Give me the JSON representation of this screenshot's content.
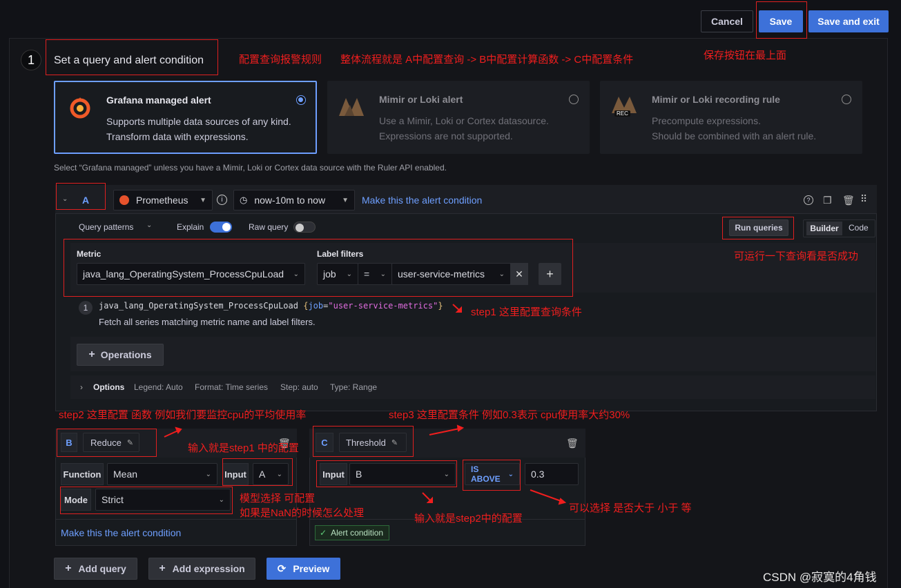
{
  "header": {
    "cancel_label": "Cancel",
    "save_label": "Save",
    "save_exit_label": "Save and exit"
  },
  "section": {
    "step_number": "1",
    "title": "Set a query and alert condition"
  },
  "alert_types": [
    {
      "title": "Grafana managed alert",
      "desc1": "Supports multiple data sources of any kind.",
      "desc2": "Transform data with expressions.",
      "selected": true
    },
    {
      "title": "Mimir or Loki alert",
      "desc1": "Use a Mimir, Loki or Cortex datasource.",
      "desc2": "Expressions are not supported.",
      "selected": false
    },
    {
      "title": "Mimir or Loki recording rule",
      "desc1": "Precompute expressions.",
      "desc2": "Should be combined with an alert rule.",
      "selected": false,
      "badge": "REC"
    }
  ],
  "hint": "Select “Grafana managed” unless you have a Mimir, Loki or Cortex data source with the Ruler API enabled.",
  "query_a": {
    "ref": "A",
    "datasource": "Prometheus",
    "time_range": "now-10m to now",
    "condition_link": "Make this the alert condition",
    "query_patterns": "Query patterns",
    "explain_label": "Explain",
    "raw_query_label": "Raw query",
    "run_queries": "Run queries",
    "builder_label": "Builder",
    "code_label": "Code",
    "metric_label": "Metric",
    "metric_value": "java_lang_OperatingSystem_ProcessCpuLoad",
    "label_filters_label": "Label filters",
    "filter_key": "job",
    "filter_op": "=",
    "filter_value": "user-service-metrics",
    "explain_num": "1",
    "explain_metric": "java_lang_OperatingSystem_ProcessCpuLoad",
    "explain_brace_open": "{",
    "explain_key": "job",
    "explain_eq": "=",
    "explain_val": "\"user-service-metrics\"",
    "explain_brace_close": "}",
    "explain_desc": "Fetch all series matching metric name and label filters.",
    "operations_label": "Operations",
    "options_label": "Options",
    "legend": "Legend: Auto",
    "format": "Format: Time series",
    "step": "Step: auto",
    "type": "Type: Range"
  },
  "expr_b": {
    "ref": "B",
    "name": "Reduce",
    "function_label": "Function",
    "function_value": "Mean",
    "input_label": "Input",
    "input_value": "A",
    "mode_label": "Mode",
    "mode_value": "Strict",
    "condition_link": "Make this the alert condition"
  },
  "expr_c": {
    "ref": "C",
    "name": "Threshold",
    "input_label": "Input",
    "input_value": "B",
    "op_value": "IS ABOVE",
    "threshold_value": "0.3",
    "alert_condition_badge": "Alert condition"
  },
  "footer": {
    "add_query": "Add query",
    "add_expression": "Add expression",
    "preview": "Preview"
  },
  "annotations": {
    "a1": "配置查询报警规则",
    "a2": "整体流程就是 A中配置查询 -> B中配置计算函数 -> C中配置条件",
    "a3": "保存按钮在最上面",
    "a4": "可运行一下查询看是否成功",
    "a5": "step1 这里配置查询条件",
    "a6": "step2 这里配置 函数  例如我们要监控cpu的平均使用率",
    "a7": "step3 这里配置条件  例如0.3表示 cpu使用率大约30%",
    "a8": "输入就是step1 中的配置",
    "a9": "模型选择 可配置",
    "a10": "如果是NaN的时候怎么处理",
    "a11": "输入就是step2中的配置",
    "a12": "可以选择 是否大于  小于 等",
    "watermark": "CSDN @寂寞的4角钱"
  }
}
